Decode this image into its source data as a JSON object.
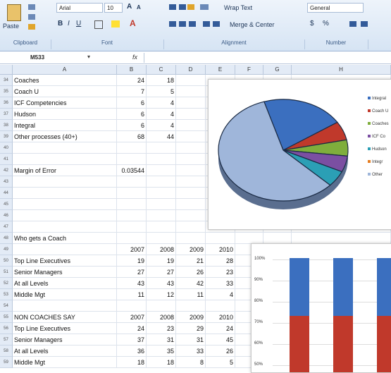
{
  "ribbon": {
    "paste": "Paste",
    "font_name": "Arial",
    "font_size": "10",
    "wrap_text": "Wrap Text",
    "merge_center": "Merge & Center",
    "number_format": "General",
    "groups": [
      "Clipboard",
      "Font",
      "Alignment",
      "Number"
    ],
    "bold": "B",
    "italic": "I",
    "underline": "U",
    "currency": "$",
    "percent": "%"
  },
  "formula_bar": {
    "name_box": "M533",
    "fx": "fx"
  },
  "columns": [
    "A",
    "B",
    "C",
    "D",
    "E",
    "F",
    "G",
    "H"
  ],
  "rows": [
    {
      "n": "34",
      "a": "Coaches",
      "b": "24",
      "c": "18",
      "d": "",
      "e": ""
    },
    {
      "n": "35",
      "a": "Coach U",
      "b": "7",
      "c": "5",
      "d": "",
      "e": ""
    },
    {
      "n": "36",
      "a": "ICF Competencies",
      "b": "6",
      "c": "4",
      "d": "",
      "e": ""
    },
    {
      "n": "37",
      "a": "Hudson",
      "b": "6",
      "c": "4",
      "d": "",
      "e": ""
    },
    {
      "n": "38",
      "a": "Integral",
      "b": "6",
      "c": "4",
      "d": "",
      "e": ""
    },
    {
      "n": "39",
      "a": "Other processes (40+)",
      "b": "68",
      "c": "44",
      "d": "",
      "e": ""
    },
    {
      "n": "40",
      "a": "",
      "b": "",
      "c": "",
      "d": "",
      "e": ""
    },
    {
      "n": "41",
      "a": "",
      "b": "",
      "c": "",
      "d": "",
      "e": ""
    },
    {
      "n": "42",
      "a": "Margin of Error",
      "b": "0.03544",
      "c": "",
      "d": "",
      "e": ""
    },
    {
      "n": "43",
      "a": "",
      "b": "",
      "c": "",
      "d": "",
      "e": ""
    },
    {
      "n": "44",
      "a": "",
      "b": "",
      "c": "",
      "d": "",
      "e": ""
    },
    {
      "n": "45",
      "a": "",
      "b": "",
      "c": "",
      "d": "",
      "e": ""
    },
    {
      "n": "46",
      "a": "",
      "b": "",
      "c": "",
      "d": "",
      "e": ""
    },
    {
      "n": "47",
      "a": "",
      "b": "",
      "c": "",
      "d": "",
      "e": ""
    },
    {
      "n": "48",
      "a": "Who gets a Coach",
      "b": "",
      "c": "",
      "d": "",
      "e": ""
    },
    {
      "n": "49",
      "a": "",
      "b": "2007",
      "c": "2008",
      "d": "2009",
      "e": "2010"
    },
    {
      "n": "50",
      "a": "Top Line Executives",
      "b": "19",
      "c": "19",
      "d": "21",
      "e": "28"
    },
    {
      "n": "51",
      "a": "Senior Managers",
      "b": "27",
      "c": "27",
      "d": "26",
      "e": "23"
    },
    {
      "n": "52",
      "a": "At all Levels",
      "b": "43",
      "c": "43",
      "d": "42",
      "e": "33"
    },
    {
      "n": "53",
      "a": "Middle Mgt",
      "b": "11",
      "c": "12",
      "d": "11",
      "e": "4"
    },
    {
      "n": "54",
      "a": "",
      "b": "",
      "c": "",
      "d": "",
      "e": ""
    },
    {
      "n": "55",
      "a": "NON COACHES SAY",
      "b": "2007",
      "c": "2008",
      "d": "2009",
      "e": "2010"
    },
    {
      "n": "56",
      "a": "Top Line Executives",
      "b": "24",
      "c": "23",
      "d": "29",
      "e": "24"
    },
    {
      "n": "57",
      "a": "Senior Managers",
      "b": "37",
      "c": "31",
      "d": "31",
      "e": "45"
    },
    {
      "n": "58",
      "a": "At all Levels",
      "b": "36",
      "c": "35",
      "d": "33",
      "e": "26"
    },
    {
      "n": "59",
      "a": "Middle Mgt",
      "b": "18",
      "c": "18",
      "d": "8",
      "e": "5"
    }
  ],
  "pie_legend": [
    "Integral",
    "Coach U",
    "Coaches",
    "ICF Co",
    "Hudson",
    "Integr",
    "Other"
  ],
  "bar_axis": [
    "100%",
    "90%",
    "80%",
    "70%",
    "60%",
    "50%"
  ],
  "colors": {
    "blue": "#3b6fbf",
    "red": "#c0392b",
    "green": "#7fae3c",
    "purple": "#7b4fa2",
    "teal": "#2b9fb5",
    "orange": "#e67e22",
    "pale": "#9fb6da"
  }
}
